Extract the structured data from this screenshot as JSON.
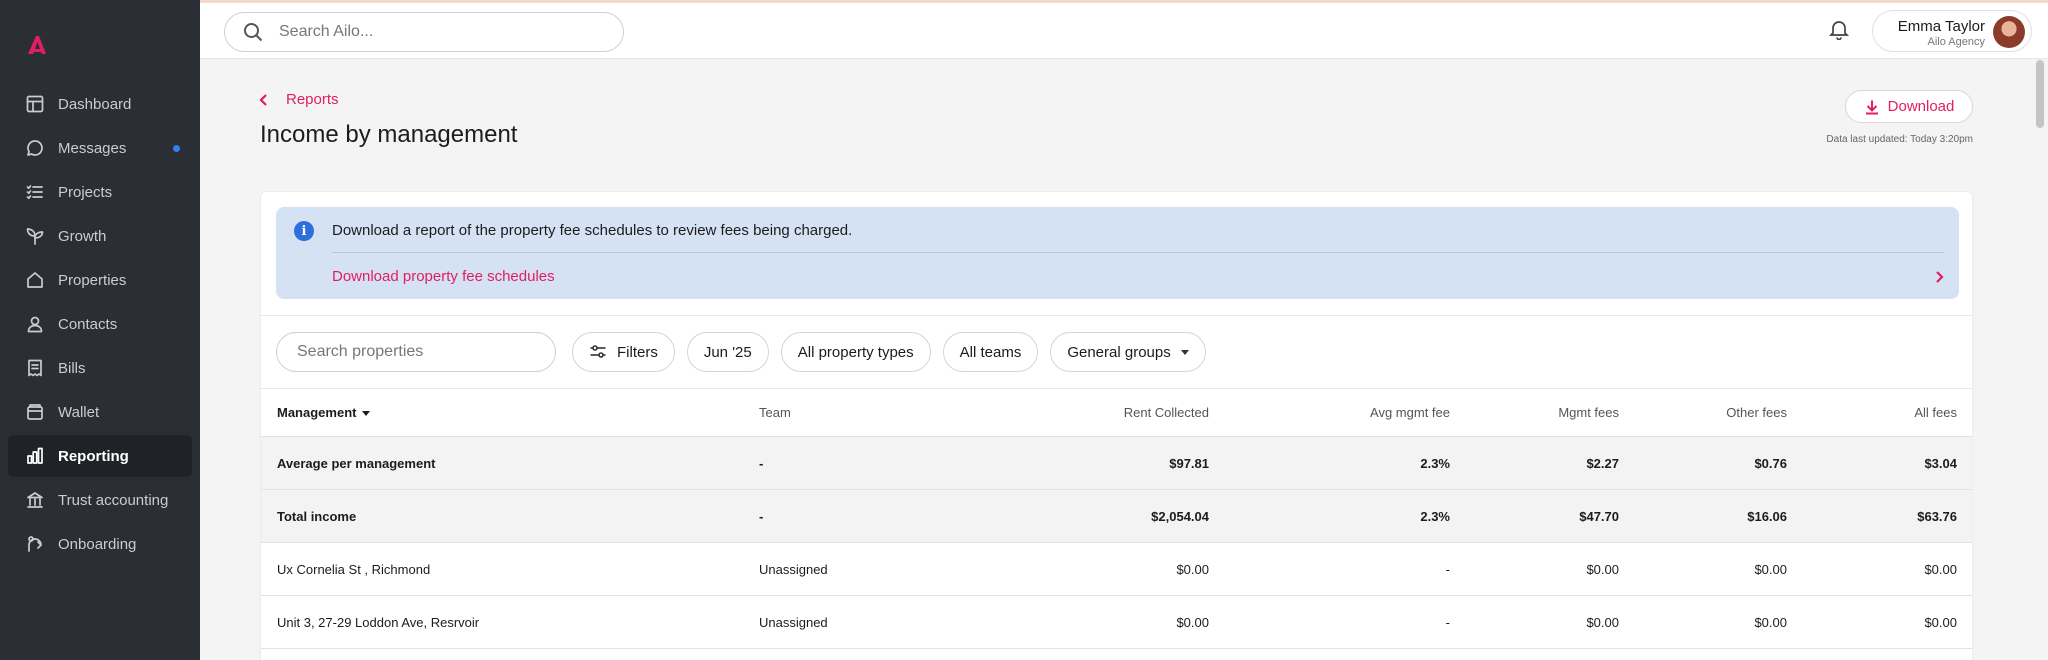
{
  "colors": {
    "accent": "#e21e62",
    "sidebar_bg": "#2b2f35",
    "info_banner": "#d5e2f4",
    "unread_dot": "#2e7ff0"
  },
  "sidebar": {
    "logo_icon": "ailo-logo-icon",
    "items": [
      {
        "label": "Dashboard",
        "icon": "dashboard-icon"
      },
      {
        "label": "Messages",
        "icon": "message-icon",
        "unread": true
      },
      {
        "label": "Projects",
        "icon": "checklist-icon"
      },
      {
        "label": "Growth",
        "icon": "sprout-icon"
      },
      {
        "label": "Properties",
        "icon": "house-icon"
      },
      {
        "label": "Contacts",
        "icon": "person-icon"
      },
      {
        "label": "Bills",
        "icon": "receipt-icon"
      },
      {
        "label": "Wallet",
        "icon": "wallet-icon"
      },
      {
        "label": "Reporting",
        "icon": "bar-chart-icon",
        "active": true
      },
      {
        "label": "Trust accounting",
        "icon": "bank-icon"
      },
      {
        "label": "Onboarding",
        "icon": "onboarding-icon"
      }
    ]
  },
  "topbar": {
    "search_placeholder": "Search Ailo...",
    "user": {
      "name": "Emma Taylor",
      "org": "Ailo Agency"
    }
  },
  "header": {
    "breadcrumb": "Reports",
    "title": "Income by management",
    "download_label": "Download",
    "last_updated": "Data last updated: Today 3:20pm"
  },
  "banner": {
    "text": "Download a report of the property fee schedules to review fees being charged.",
    "link": "Download property fee schedules"
  },
  "filters": {
    "search_placeholder": "Search properties",
    "filters_label": "Filters",
    "period": "Jun '25",
    "property_types": "All property types",
    "teams": "All teams",
    "groups": "General groups"
  },
  "table": {
    "columns": [
      "Management",
      "Team",
      "Rent Collected",
      "Avg mgmt fee",
      "Mgmt fees",
      "Other fees",
      "All fees"
    ],
    "summary_rows": [
      {
        "name": "Average per management",
        "team": "-",
        "rent": "$97.81",
        "avg": "2.3%",
        "mgmt": "$2.27",
        "other": "$0.76",
        "all": "$3.04"
      },
      {
        "name": "Total income",
        "team": "-",
        "rent": "$2,054.04",
        "avg": "2.3%",
        "mgmt": "$47.70",
        "other": "$16.06",
        "all": "$63.76"
      }
    ],
    "rows": [
      {
        "name": "Ux Cornelia St , Richmond",
        "team": "Unassigned",
        "rent": "$0.00",
        "avg": "-",
        "mgmt": "$0.00",
        "other": "$0.00",
        "all": "$0.00"
      },
      {
        "name": "Unit 3, 27-29 Loddon Ave, Resrvoir",
        "team": "Unassigned",
        "rent": "$0.00",
        "avg": "-",
        "mgmt": "$0.00",
        "other": "$0.00",
        "all": "$0.00"
      }
    ]
  }
}
